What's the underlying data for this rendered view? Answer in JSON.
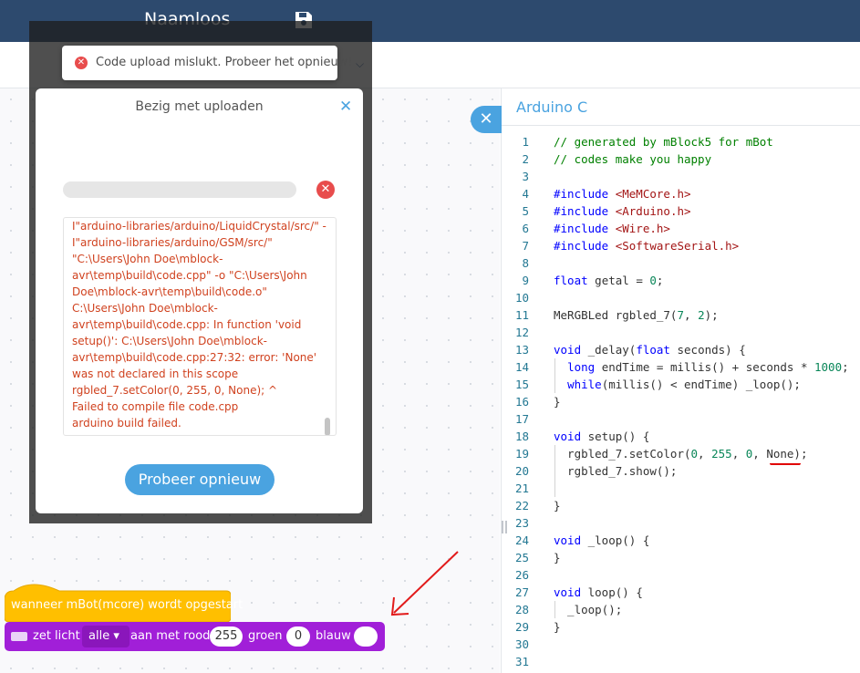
{
  "header": {
    "project_title": "Naamloos",
    "save_icon": "save-icon"
  },
  "toast": {
    "message": "Code upload mislukt. Probeer het opnieuw!",
    "icon": "x-circle-icon"
  },
  "dialog": {
    "title": "Bezig met uploaden",
    "close_icon": "close-icon",
    "log_lines": [
      "I\"arduino-libraries/arduino/LiquidCrystal/src/\" -",
      "I\"arduino-libraries/arduino/GSM/src/\"",
      "\"C:\\Users\\John Doe\\mblock-",
      "avr\\temp\\build\\code.cpp\" -o \"C:\\Users\\John",
      "Doe\\mblock-avr\\temp\\build\\code.o\"",
      "C:\\Users\\John Doe\\mblock-",
      "avr\\temp\\build\\code.cpp: In function 'void",
      "setup()': C:\\Users\\John Doe\\mblock-",
      "avr\\temp\\build\\code.cpp:27:32: error: 'None'",
      "was not declared in this scope",
      "rgbled_7.setColor(0, 255, 0, None); ^",
      "Failed to compile file code.cpp",
      "arduino build failed."
    ],
    "retry_label": "Probeer opnieuw"
  },
  "blocks": {
    "hat_label": "wanneer mBot(mcore) wordt opgestart",
    "cmd": {
      "text1": "zet licht",
      "dropdown": "alle ▾",
      "text2": "aan met rood",
      "red": "255",
      "text3": "groen",
      "green": "0",
      "text4": "blauw",
      "blue": ""
    }
  },
  "code_panel": {
    "title": "Arduino C",
    "collapse_icon": "close-icon",
    "lines": [
      {
        "n": "1",
        "t": "// generated by mBlock5 for mBot"
      },
      {
        "n": "2",
        "t": "// codes make you happy"
      },
      {
        "n": "3",
        "t": ""
      },
      {
        "n": "4",
        "t": "#include <MeMCore.h>"
      },
      {
        "n": "5",
        "t": "#include <Arduino.h>"
      },
      {
        "n": "6",
        "t": "#include <Wire.h>"
      },
      {
        "n": "7",
        "t": "#include <SoftwareSerial.h>"
      },
      {
        "n": "8",
        "t": ""
      },
      {
        "n": "9",
        "t": "float getal = 0;"
      },
      {
        "n": "10",
        "t": ""
      },
      {
        "n": "11",
        "t": "MeRGBLed rgbled_7(7, 2);"
      },
      {
        "n": "12",
        "t": ""
      },
      {
        "n": "13",
        "t": "void _delay(float seconds) {"
      },
      {
        "n": "14",
        "t": "  long endTime = millis() + seconds * 1000;"
      },
      {
        "n": "15",
        "t": "  while(millis() < endTime) _loop();"
      },
      {
        "n": "16",
        "t": "}"
      },
      {
        "n": "17",
        "t": ""
      },
      {
        "n": "18",
        "t": "void setup() {"
      },
      {
        "n": "19",
        "t": "  rgbled_7.setColor(0, 255, 0, None);"
      },
      {
        "n": "20",
        "t": "  rgbled_7.show();"
      },
      {
        "n": "21",
        "t": ""
      },
      {
        "n": "22",
        "t": "}"
      },
      {
        "n": "23",
        "t": ""
      },
      {
        "n": "24",
        "t": "void _loop() {"
      },
      {
        "n": "25",
        "t": "}"
      },
      {
        "n": "26",
        "t": ""
      },
      {
        "n": "27",
        "t": "void loop() {"
      },
      {
        "n": "28",
        "t": "  _loop();"
      },
      {
        "n": "29",
        "t": "}"
      },
      {
        "n": "30",
        "t": ""
      },
      {
        "n": "31",
        "t": ""
      }
    ]
  },
  "colors": {
    "header": "#2d4a6e",
    "accent": "#4aa3e0",
    "error": "#e84c4c",
    "block_event": "#ffbf00",
    "block_light": "#a11fd8"
  }
}
